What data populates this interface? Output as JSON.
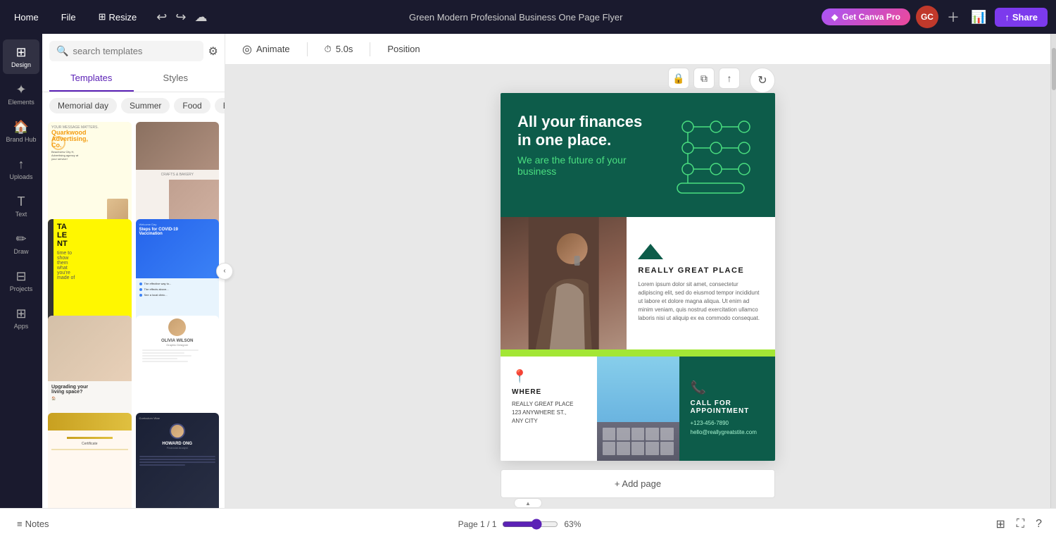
{
  "app": {
    "title": "Green Modern Profesional Business One Page Flyer",
    "home_label": "Home",
    "file_label": "File",
    "resize_label": "Resize",
    "canva_pro_label": "Get Canva Pro",
    "share_label": "Share",
    "avatar_initials": "GC"
  },
  "toolbar_secondary": {
    "animate_label": "Animate",
    "duration_label": "5.0s",
    "position_label": "Position"
  },
  "sidebar": {
    "items": [
      {
        "id": "design",
        "label": "Design",
        "icon": "⊞"
      },
      {
        "id": "elements",
        "label": "Elements",
        "icon": "✦"
      },
      {
        "id": "brand-hub",
        "label": "Brand Hub",
        "icon": "🏠"
      },
      {
        "id": "uploads",
        "label": "Uploads",
        "icon": "↑"
      },
      {
        "id": "text",
        "label": "Text",
        "icon": "T"
      },
      {
        "id": "draw",
        "label": "Draw",
        "icon": "✏"
      },
      {
        "id": "projects",
        "label": "Projects",
        "icon": "⊟"
      },
      {
        "id": "apps",
        "label": "Apps",
        "icon": "⋯"
      }
    ]
  },
  "templates_panel": {
    "search_placeholder": "search templates",
    "tabs": [
      "Templates",
      "Styles"
    ],
    "active_tab": "Templates",
    "categories": [
      "Memorial day",
      "Summer",
      "Food",
      "Blue"
    ],
    "filter_icon": "⚙"
  },
  "flyer": {
    "hero": {
      "line1": "All your finances",
      "line2": "in one place.",
      "tagline": "We are the future of your business"
    },
    "section2": {
      "company": "REALLY GREAT PLACE",
      "description": "Lorem ipsum dolor sit amet, consectetur adipiscing elit, sed do eiusmod tempor incididunt ut labore et dolore magna aliqua. Ut enim ad minim veniam, quis nostrud exercitation ullamco laboris nisi ut aliquip ex ea commodo consequat."
    },
    "where": {
      "heading": "WHERE",
      "line1": "REALLY GREAT PLACE",
      "line2": "123 ANYWHERE ST.,",
      "line3": "ANY CITY"
    },
    "call": {
      "heading": "CALL FOR APPOINTMENT",
      "phone": "+123-456-7890",
      "email": "hello@reallygreatstite.com"
    },
    "add_page_label": "+ Add page",
    "page_info": "Page 1 / 1",
    "zoom_label": "63%"
  },
  "bottombar": {
    "notes_label": "Notes",
    "page_info": "Page 1 / 1",
    "zoom_level": "63%"
  }
}
